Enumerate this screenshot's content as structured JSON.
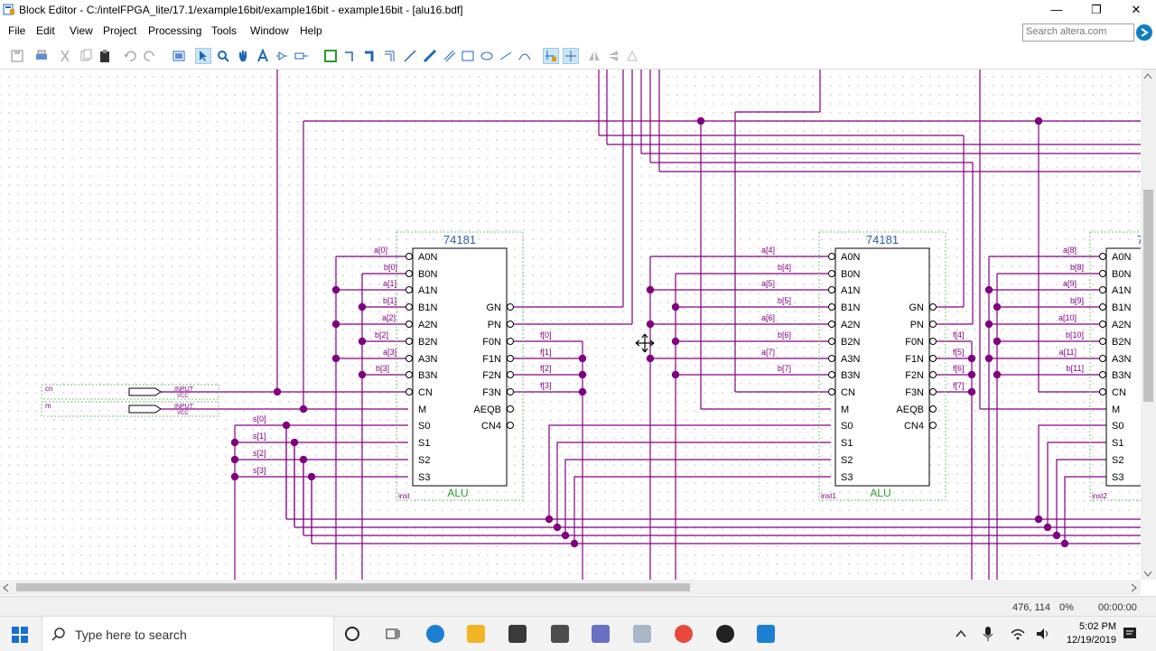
{
  "window": {
    "title": "Block Editor - C:/intelFPGA_lite/17.1/example16bit/example16bit - example16bit - [alu16.bdf]",
    "minimize_glyph": "—",
    "restore_glyph": "❐",
    "close_glyph": "✕"
  },
  "menu": [
    "File",
    "Edit",
    "View",
    "Project",
    "Processing",
    "Tools",
    "Window",
    "Help"
  ],
  "search": {
    "placeholder": "Search altera.com"
  },
  "schematic": {
    "chip_type": "74181",
    "chip_label": "ALU",
    "instances": [
      "inst",
      "inst1",
      "inst2"
    ],
    "inputs_left": [
      "A0N",
      "B0N",
      "A1N",
      "B1N",
      "A2N",
      "B2N",
      "A3N",
      "B3N",
      "CN",
      "M",
      "S0",
      "S1",
      "S2",
      "S3"
    ],
    "outputs_right": [
      "GN",
      "PN",
      "F0N",
      "F1N",
      "F2N",
      "F3N",
      "AEQB",
      "CN4"
    ],
    "input_pins": [
      {
        "name": "cn",
        "type": "INPUT",
        "default": "VCC"
      },
      {
        "name": "m",
        "type": "INPUT",
        "default": "VCC"
      }
    ],
    "select_labels": [
      "s[0]",
      "s[1]",
      "s[2]",
      "s[3]"
    ],
    "inst0_in_labels": [
      "a[0]",
      "b[0]",
      "a[1]",
      "b[1]",
      "a[2]",
      "b[2]",
      "a[3]",
      "b[3]"
    ],
    "inst0_out_labels": [
      "f[0]",
      "f[1]",
      "f[2]",
      "f[3]"
    ],
    "inst1_in_labels": [
      "a[4]",
      "b[4]",
      "a[5]",
      "b[5]",
      "a[6]",
      "b[6]",
      "a[7]",
      "b[7]"
    ],
    "inst1_out_labels": [
      "f[4]",
      "f[5]",
      "f[6]",
      "f[7]"
    ],
    "inst2_in_labels": [
      "a[8]",
      "b[8]",
      "a[9]",
      "b[9]",
      "a[10]",
      "b[10]",
      "a[11]",
      "b[11]"
    ],
    "wire_color": "#800080",
    "label_color": "#800080",
    "chip_title_color": "#2d5fa8",
    "alu_label_color": "#2e9a2e",
    "instance_border_color": "#7fbf7f"
  },
  "status": {
    "coords": "476, 114",
    "zoom": "0%",
    "time": "00:00:00"
  },
  "taskbar": {
    "search_placeholder": "Type here to search",
    "time": "5:02 PM",
    "date": "12/19/2019"
  }
}
